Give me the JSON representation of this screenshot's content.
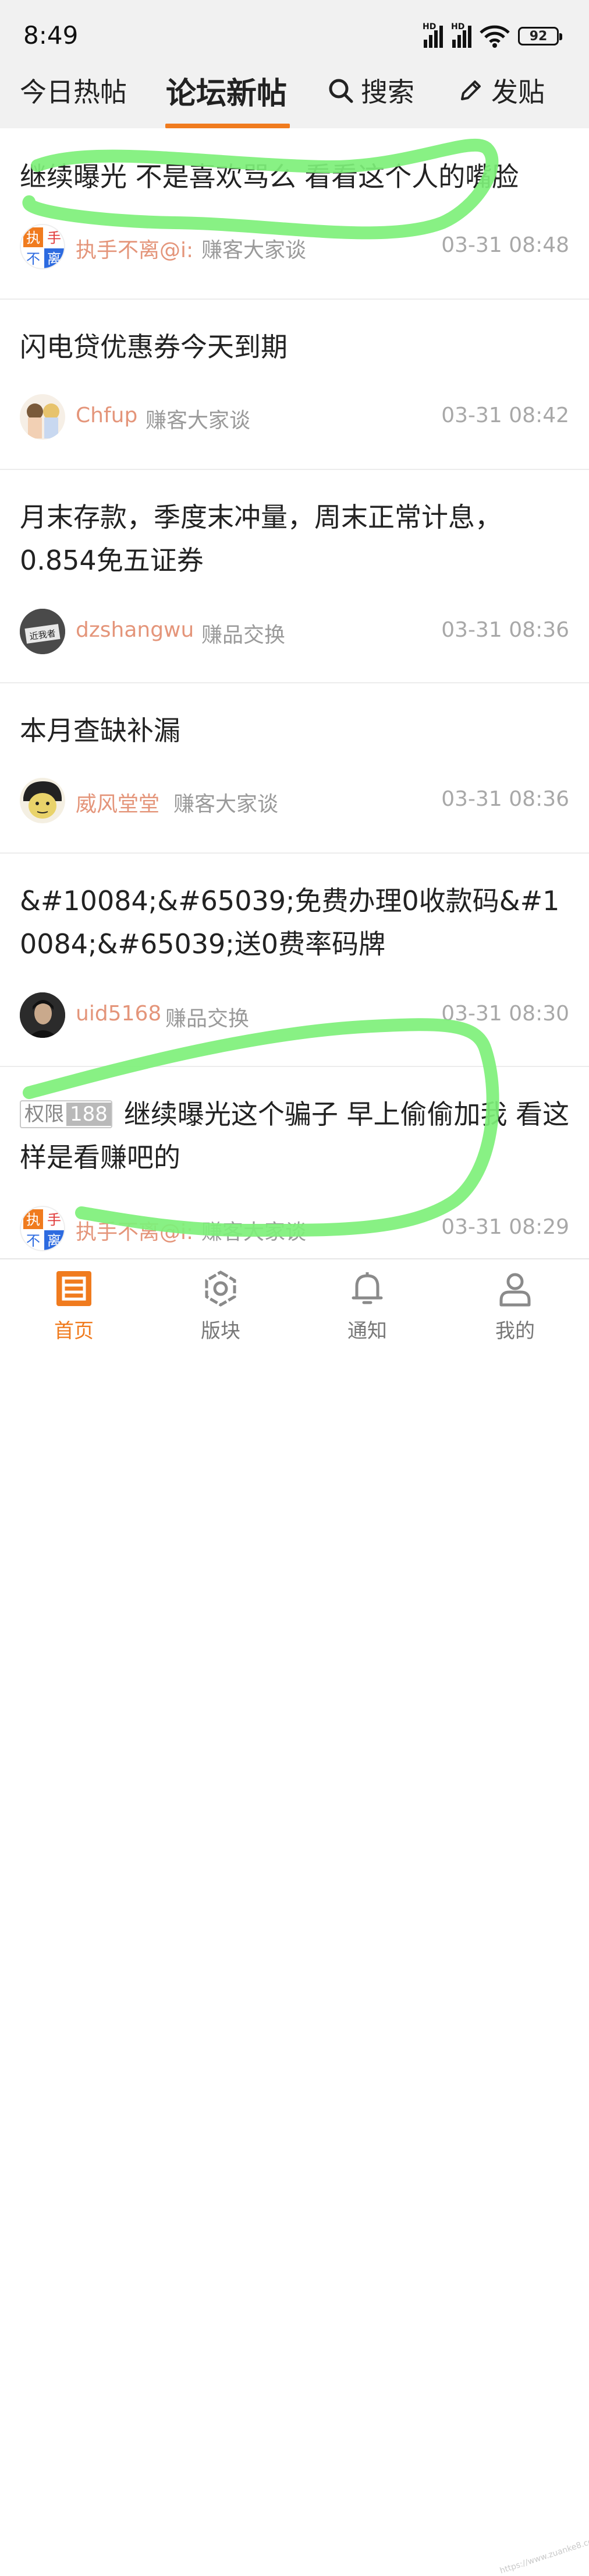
{
  "status": {
    "time": "8:49",
    "battery": "92",
    "hd1": "HD",
    "hd2": "HD"
  },
  "tabs": {
    "hot": "今日热帖",
    "new": "论坛新帖",
    "search": "搜索",
    "post": "发贴"
  },
  "posts": [
    {
      "title": "继续曝光 不是喜欢骂么 看看这个人的嘴脸",
      "author": "执手不离@i:",
      "board": "赚客大家谈",
      "time": "03-31 08:48"
    },
    {
      "title": "闪电贷优惠券今天到期",
      "author": "Chfup",
      "board": "赚客大家谈",
      "time": "03-31 08:42"
    },
    {
      "title": "月末存款，季度末冲量，周末正常计息，0.854免五证券",
      "author": "dzshangwu",
      "board": "赚品交换",
      "time": "03-31 08:36"
    },
    {
      "title": "本月查缺补漏",
      "author": "威风堂堂",
      "board": "赚客大家谈",
      "time": "03-31 08:36"
    },
    {
      "title": "&#10084;&#65039;免费办理0收款码&#10084;&#65039;送0费率码牌",
      "author": "uid5168",
      "board": "赚品交换",
      "time": "03-31 08:30"
    },
    {
      "tag_a": "权限",
      "tag_b": "188",
      "title": "继续曝光这个骗子 早上偷偷加我 看这样是看赚吧的",
      "author": "执手不离@i:",
      "board": "赚客大家谈",
      "time": "03-31 08:29"
    }
  ],
  "avatar_text": {
    "a": "执",
    "b": "手",
    "c": "不",
    "d": "离",
    "e": "近我者"
  },
  "bottom_nav": [
    {
      "label": "首页",
      "icon": "home-icon"
    },
    {
      "label": "版块",
      "icon": "board-icon"
    },
    {
      "label": "通知",
      "icon": "bell-icon"
    },
    {
      "label": "我的",
      "icon": "user-icon"
    }
  ],
  "watermark": "https://www.zuanke8.com",
  "colors": {
    "accent": "#f07b1e",
    "author": "#e4957a",
    "highlight": "#7ef07a"
  }
}
